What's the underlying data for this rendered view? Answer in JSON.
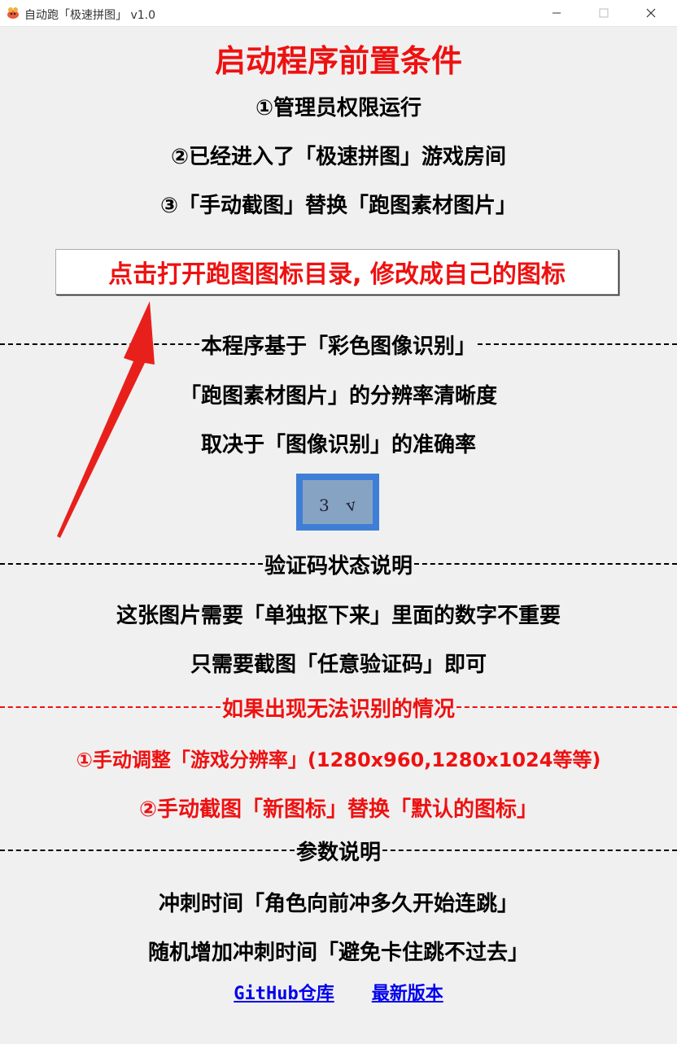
{
  "window": {
    "title": "自动跑「极速拼图」 v1.0"
  },
  "prereq": {
    "heading": "启动程序前置条件",
    "items": [
      "①管理员权限运行",
      "②已经进入了「极速拼图」游戏房间",
      "③「手动截图」替换「跑图素材图片」"
    ]
  },
  "open_button": {
    "label": "点击打开跑图图标目录, 修改成自己的图标"
  },
  "section_recognition": {
    "title": "本程序基于「彩色图像识别」",
    "lines": [
      "「跑图素材图片」的分辨率清晰度",
      "取决于「图像识别」的准确率"
    ]
  },
  "section_captcha": {
    "title": "验证码状态说明",
    "lines": [
      "这张图片需要「单独抠下来」里面的数字不重要",
      "只需要截图「任意验证码」即可"
    ]
  },
  "section_failure": {
    "title": "如果出现无法识别的情况",
    "lines": [
      "①手动调整「游戏分辨率」(1280x960,1280x1024等等)",
      "②手动截图「新图标」替换「默认的图标」"
    ]
  },
  "section_params": {
    "title": "参数说明",
    "lines": [
      "冲刺时间「角色向前冲多久开始连跳」",
      "随机增加冲刺时间「避免卡住跳不过去」"
    ]
  },
  "links": {
    "github": "GitHub仓库",
    "latest": "最新版本"
  },
  "colors": {
    "accent_red": "#ee1111",
    "link_blue": "#0000ee",
    "window_bg": "#f0f0f0"
  },
  "icons": [
    "app-icon",
    "minimize-icon",
    "maximize-icon",
    "close-icon",
    "arrow-annotation",
    "captcha-image"
  ]
}
